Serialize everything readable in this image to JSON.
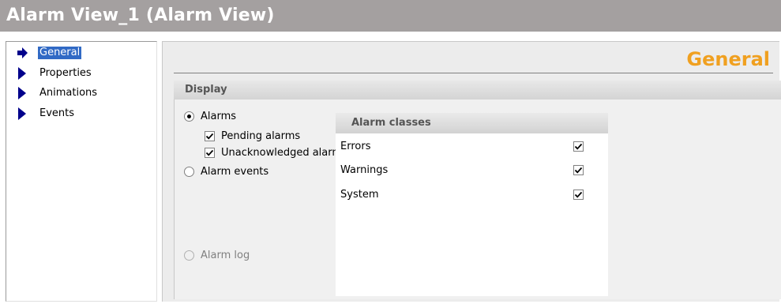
{
  "window": {
    "title": "Alarm View_1 (Alarm View)"
  },
  "nav": {
    "items": [
      {
        "label": "General",
        "selected": true
      },
      {
        "label": "Properties",
        "selected": false
      },
      {
        "label": "Animations",
        "selected": false
      },
      {
        "label": "Events",
        "selected": false
      }
    ]
  },
  "main": {
    "section_title": "General",
    "display": {
      "header": "Display",
      "options": {
        "alarms": "Alarms",
        "pending": "Pending alarms",
        "unacknowledged": "Unacknowledged alarms",
        "alarm_events": "Alarm events",
        "alarm_log": "Alarm log"
      },
      "selected": "alarms",
      "pending_checked": true,
      "unacknowledged_checked": true
    },
    "alarm_classes": {
      "header": "Alarm classes",
      "rows": [
        {
          "name": "Errors",
          "checked": true
        },
        {
          "name": "Warnings",
          "checked": true
        },
        {
          "name": "System",
          "checked": true
        }
      ]
    }
  },
  "colors": {
    "title_bar": "#a4a0a0",
    "section_title": "#f0a020",
    "selection": "#316ac5",
    "nav_arrow": "#00008b"
  }
}
